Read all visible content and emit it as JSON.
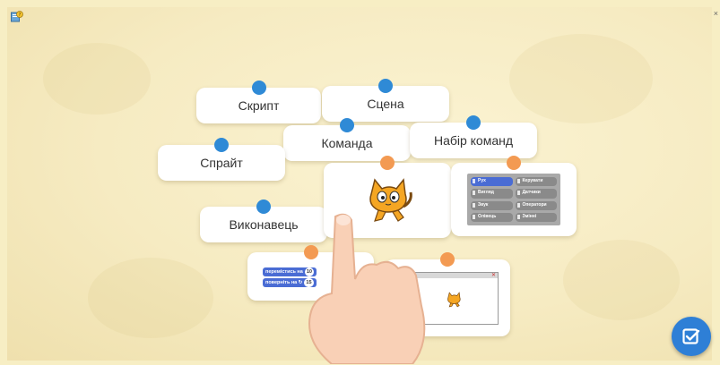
{
  "cards": {
    "script": "Скрипт",
    "scene": "Сцена",
    "command": "Команда",
    "command_set": "Набір команд",
    "sprite": "Спрайт",
    "executor": "Виконавець"
  },
  "palette": [
    {
      "label": "Рух",
      "color": "#4a6cd4"
    },
    {
      "label": "Керувати",
      "color": "#e1a91a"
    },
    {
      "label": "Вигляд",
      "color": "#8a55d7"
    },
    {
      "label": "Датчики",
      "color": "#2ca5e2"
    },
    {
      "label": "Звук",
      "color": "#bb42c3"
    },
    {
      "label": "Оператори",
      "color": "#5cb712"
    },
    {
      "label": "Олівець",
      "color": "#0e9a6c"
    },
    {
      "label": "Змінні",
      "color": "#ee7d16"
    }
  ],
  "blocks": {
    "move_label": "перемістись на",
    "move_value": "10",
    "turn_label": "поверніть на ↻",
    "turn_value": "15"
  },
  "colors": {
    "dot_blue": "#2f8ad6",
    "dot_orange": "#f39a52",
    "check_button": "#2e7fd6"
  },
  "icons": {
    "help": "help-icon",
    "check": "check-icon",
    "cat": "scratch-cat-icon",
    "hand": "pointing-hand-icon"
  }
}
